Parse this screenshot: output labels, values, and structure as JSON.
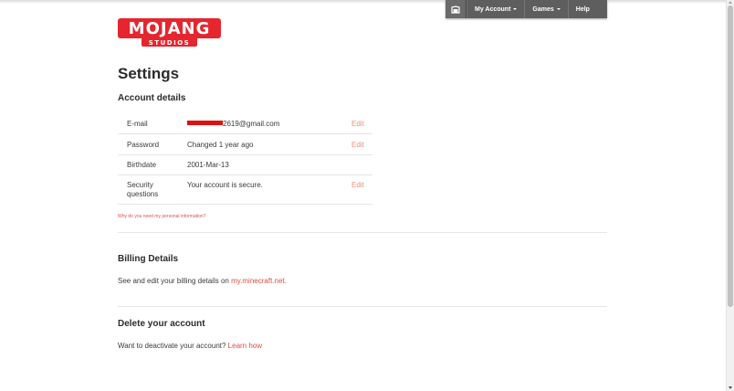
{
  "nav": {
    "home_icon": "house-icon",
    "items": [
      {
        "label": "My Account",
        "dropdown": true
      },
      {
        "label": "Games",
        "dropdown": true
      },
      {
        "label": "Help",
        "dropdown": false
      }
    ]
  },
  "logo": {
    "line1": "MOJANG",
    "line2": "STUDIOS",
    "color": "#e5262f"
  },
  "page_title": "Settings",
  "account_details": {
    "title": "Account details",
    "rows": [
      {
        "label": "E-mail",
        "value": "2619@gmail.com",
        "redacted": true,
        "edit": "Edit"
      },
      {
        "label": "Password",
        "value": "Changed 1 year ago",
        "edit": "Edit"
      },
      {
        "label": "Birthdate",
        "value": "2001-Mar-13",
        "edit": ""
      },
      {
        "label_line1": "Security",
        "label_line2": "questions",
        "value": "Your account is secure.",
        "edit": "Edit"
      }
    ],
    "why_link": "Why do you need my personal information?"
  },
  "billing": {
    "title": "Billing Details",
    "text": "See and edit your billing details on ",
    "link": "my.minecraft.net."
  },
  "delete": {
    "title": "Delete your account",
    "text": "Want to deactivate your account? ",
    "link": "Learn how"
  },
  "colors": {
    "link": "#e04b45",
    "edit": "#e8937a",
    "nav_bg": "#5e5e5e"
  }
}
